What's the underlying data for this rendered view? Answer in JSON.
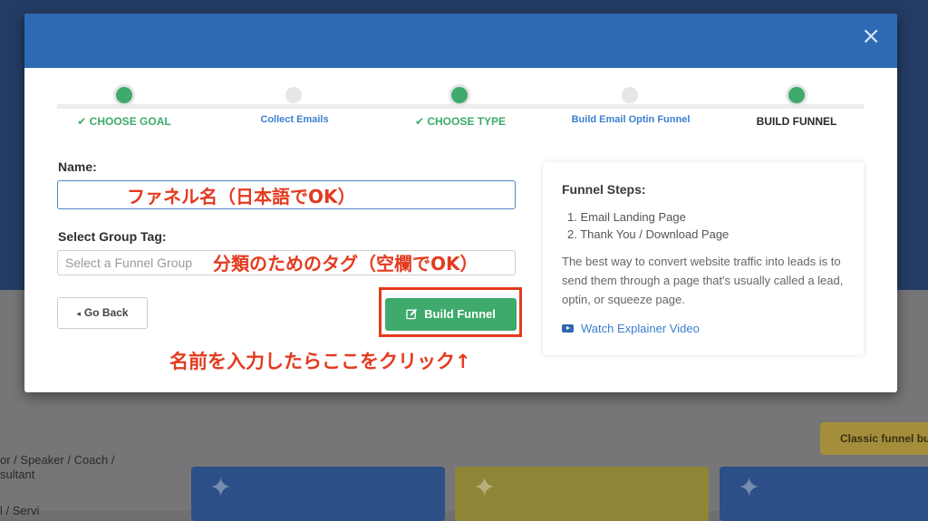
{
  "background": {
    "left_text_line1": "or / Speaker / Coach /",
    "left_text_line2": "sultant",
    "left_text_line3": "l / Servi",
    "classic_button": "Classic funnel bu"
  },
  "modal": {
    "close_icon": "×",
    "steps": [
      {
        "label": "✔ CHOOSE GOAL",
        "state": "done"
      },
      {
        "label": "Collect Emails",
        "state": "sub"
      },
      {
        "label": "✔ CHOOSE TYPE",
        "state": "done"
      },
      {
        "label": "Build Email Optin Funnel",
        "state": "sub"
      },
      {
        "label": "BUILD FUNNEL",
        "state": "current"
      }
    ],
    "form": {
      "name_label": "Name:",
      "name_value": "",
      "group_label": "Select Group Tag:",
      "group_placeholder": "Select a Funnel Group",
      "go_back_label": "Go Back",
      "go_back_icon": "◂",
      "build_label": "Build Funnel",
      "build_icon": "edit-icon"
    },
    "side_panel": {
      "title": "Funnel Steps:",
      "steps": [
        "1. Email Landing Page",
        "2. Thank You / Download Page"
      ],
      "description": "The best way to convert website traffic into leads is to send them through a page that's usually called a lead, optin, or squeeze page.",
      "link": "Watch Explainer Video"
    }
  },
  "annotations": {
    "name_hint": "ファネル名（日本語でOK）",
    "group_hint": "分類のためのタグ（空欄でOK）",
    "click_hint": "名前を入力したらここをクリック↑"
  },
  "colors": {
    "header": "#2e6ab3",
    "accent_green": "#3eaa6b",
    "annotation_red": "#e33b1f"
  }
}
